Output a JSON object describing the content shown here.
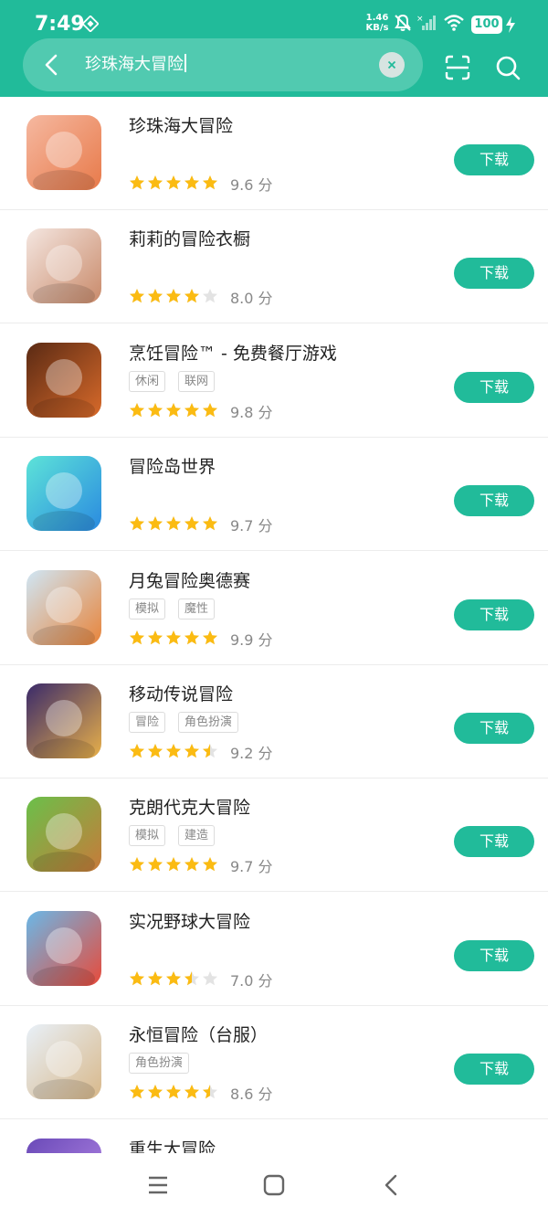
{
  "status": {
    "time": "7:49",
    "net_speed": "1.46",
    "net_unit": "KB/s",
    "battery": "100"
  },
  "search": {
    "query": "珍珠海大冒险"
  },
  "download_label": "下载",
  "apps": [
    {
      "name": "珍珠海大冒险",
      "tags": [],
      "stars": 5,
      "score": "9.6 分",
      "icon": "app-icon-pearl-sea",
      "colors": [
        "#f5b8a0",
        "#e87a4a"
      ]
    },
    {
      "name": "莉莉的冒险衣橱",
      "tags": [],
      "stars": 4,
      "score": "8.0 分",
      "icon": "app-icon-lily-wardrobe",
      "colors": [
        "#f4e6e0",
        "#c98a6a"
      ]
    },
    {
      "name": "烹饪冒险™ - 免费餐厅游戏",
      "tags": [
        "休闲",
        "联网"
      ],
      "stars": 5,
      "score": "9.8 分",
      "icon": "app-icon-cooking",
      "colors": [
        "#5a2a14",
        "#d86a2a"
      ]
    },
    {
      "name": "冒险岛世界",
      "tags": [],
      "stars": 5,
      "score": "9.7 分",
      "icon": "app-icon-maplestory-worlds",
      "colors": [
        "#5de3d8",
        "#2a8ae0"
      ]
    },
    {
      "name": "月兔冒险奥德赛",
      "tags": [
        "模拟",
        "魔性"
      ],
      "stars": 5,
      "score": "9.9 分",
      "icon": "app-icon-moon-rabbit",
      "colors": [
        "#cfe6f5",
        "#e8843a"
      ]
    },
    {
      "name": "移动传说冒险",
      "tags": [
        "冒险",
        "角色扮演"
      ],
      "stars": 4.5,
      "score": "9.2 分",
      "icon": "app-icon-collab",
      "colors": [
        "#3a2a6a",
        "#e8b04a"
      ]
    },
    {
      "name": "克朗代克大冒险",
      "tags": [
        "模拟",
        "建造"
      ],
      "stars": 5,
      "score": "9.7 分",
      "icon": "app-icon-klondike",
      "colors": [
        "#6ac04a",
        "#c87a3a"
      ]
    },
    {
      "name": "实况野球大冒险",
      "tags": [],
      "stars": 3.5,
      "score": "7.0 分",
      "icon": "app-icon-konami",
      "colors": [
        "#6ab8e8",
        "#e84a3a"
      ]
    },
    {
      "name": "永恒冒险（台服）",
      "tags": [
        "角色扮演"
      ],
      "stars": 4.5,
      "score": "8.6 分",
      "icon": "app-icon-eternal",
      "colors": [
        "#e8f0f8",
        "#d8b88a"
      ]
    },
    {
      "name": "重生大冒险",
      "tags": [],
      "stars": 0,
      "score": "",
      "icon": "app-icon-rebirth",
      "colors": [
        "#6a4ab8",
        "#b88ae8"
      ]
    }
  ]
}
